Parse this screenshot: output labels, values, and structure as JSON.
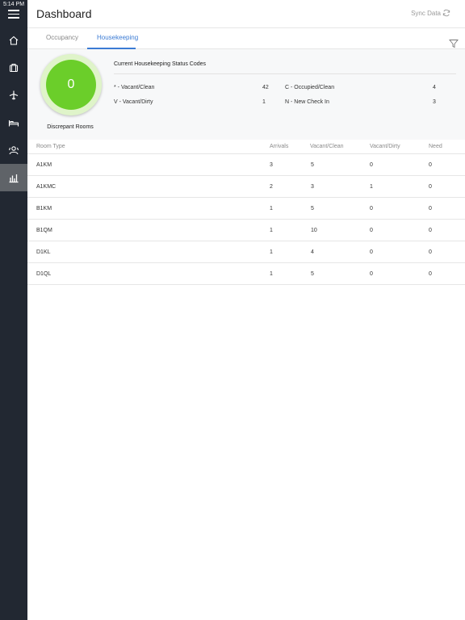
{
  "status_bar": {
    "time": "5:14 PM"
  },
  "header": {
    "title": "Dashboard",
    "sync_label": "Sync Data"
  },
  "tabs": [
    {
      "label": "Occupancy",
      "active": false
    },
    {
      "label": "Housekeeping",
      "active": true
    }
  ],
  "discrepant": {
    "count": "0",
    "label": "Discrepant Rooms"
  },
  "status_codes": {
    "title": "Current Housekeeping Status Codes",
    "items": [
      {
        "label": "* - Vacant/Clean",
        "value": "42"
      },
      {
        "label": "C - Occupied/Clean",
        "value": "4"
      },
      {
        "label": "V - Vacant/Dirty",
        "value": "1"
      },
      {
        "label": "N - New Check In",
        "value": "3"
      }
    ]
  },
  "table": {
    "columns": [
      "Room Type",
      "Arrivals",
      "Vacant/Clean",
      "Vacant/Dirty",
      "Need"
    ],
    "rows": [
      [
        "A1KM",
        "3",
        "5",
        "0",
        "0"
      ],
      [
        "A1KMC",
        "2",
        "3",
        "1",
        "0"
      ],
      [
        "B1KM",
        "1",
        "5",
        "0",
        "0"
      ],
      [
        "B1QM",
        "1",
        "10",
        "0",
        "0"
      ],
      [
        "D1KL",
        "1",
        "4",
        "0",
        "0"
      ],
      [
        "D1QL",
        "1",
        "5",
        "0",
        "0"
      ]
    ]
  },
  "colors": {
    "sidebar": "#222832",
    "accent": "#3b7bd4",
    "circle": "#6bce2a"
  },
  "icons": [
    "menu-icon",
    "home-icon",
    "luggage-icon",
    "plane-icon",
    "bed-icon",
    "housekeeping-icon",
    "chart-icon",
    "sync-icon",
    "filter-icon"
  ]
}
